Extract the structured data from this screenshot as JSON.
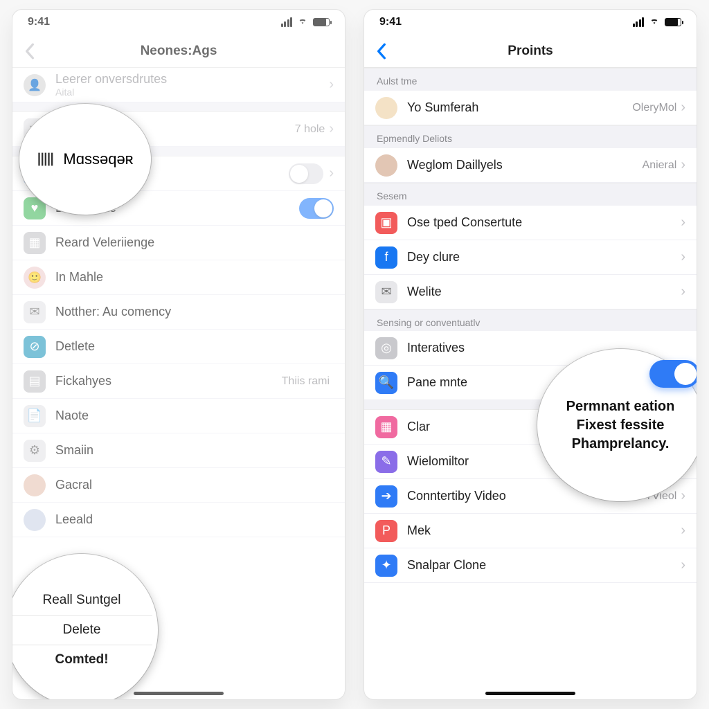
{
  "status": {
    "time": "9:41"
  },
  "left": {
    "nav_title": "Neones:Ags",
    "rows": [
      {
        "label": "Leerer onversdrutes",
        "muted_label": "Aital"
      },
      {
        "label": "Massaqer",
        "detail": "7 hole"
      },
      {
        "label": ""
      },
      {
        "label": "Brilla Loike"
      },
      {
        "label": "Reard Veleriienge"
      },
      {
        "label": "In Mahle"
      },
      {
        "label": "Notther: Au comency"
      },
      {
        "label": "Detlete"
      },
      {
        "label": "Fickahyes",
        "detail": "Thiis rami"
      },
      {
        "label": "Naote"
      },
      {
        "label": "Smaiin"
      },
      {
        "label": "Gacral"
      },
      {
        "label": "Leeald"
      }
    ],
    "callout_top_label": "Mɑssəqəʀ",
    "callout_bottom": [
      "Reall Suntgel",
      "Delete",
      "Comted!"
    ]
  },
  "right": {
    "nav_title": "Proints",
    "sections": {
      "s1": "Aulst tme",
      "s2": "Epmendly Deliots",
      "s3": "Sesem",
      "s4": "Sensing or conventuatlv"
    },
    "rows": {
      "r1": {
        "label": "Yo Sumferah",
        "detail": "OleryMol"
      },
      "r2": {
        "label": "Weglom Daillyels",
        "detail": "Anieral"
      },
      "r3": {
        "label": "Ose tped Consertute"
      },
      "r4": {
        "label": "Dey clure"
      },
      "r5": {
        "label": "Welite"
      },
      "r6": {
        "label": "Interatives"
      },
      "r7": {
        "label": "Pane mnte"
      },
      "r8": {
        "label": "Clar"
      },
      "r9": {
        "label": "Wielomiltor"
      },
      "r10": {
        "label": "Conntertiby Video",
        "detail": "7Vieol"
      },
      "r11": {
        "label": "Mek"
      },
      "r12": {
        "label": "Snalpar Clone"
      }
    },
    "callout": [
      "Permnant eation",
      "Fixest fessite",
      "Phamprelancy."
    ]
  }
}
